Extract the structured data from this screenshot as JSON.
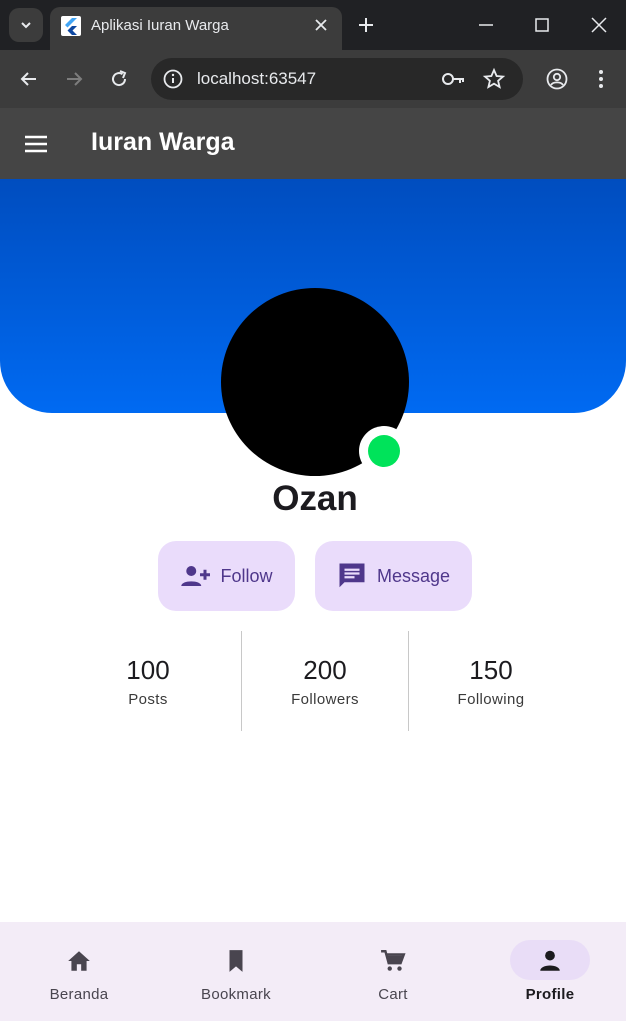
{
  "browser": {
    "tab_title": "Aplikasi Iuran Warga",
    "url": "localhost:63547"
  },
  "app": {
    "title": "Iuran Warga"
  },
  "profile": {
    "name": "Ozan",
    "online": true,
    "status_color": "#00e35a"
  },
  "actions": {
    "follow_label": "Follow",
    "message_label": "Message"
  },
  "stats": [
    {
      "value": "100",
      "label": "Posts"
    },
    {
      "value": "200",
      "label": "Followers"
    },
    {
      "value": "150",
      "label": "Following"
    }
  ],
  "bottom_nav": {
    "items": [
      {
        "label": "Beranda",
        "icon": "home-icon"
      },
      {
        "label": "Bookmark",
        "icon": "bookmark-icon"
      },
      {
        "label": "Cart",
        "icon": "cart-icon"
      },
      {
        "label": "Profile",
        "icon": "person-icon"
      }
    ],
    "active_index": 3
  },
  "colors": {
    "banner_top": "#004dbf",
    "banner_bottom": "#006af2",
    "app_bar": "#454545",
    "button_bg": "#eadcfb",
    "button_fg": "#4f378b",
    "nav_bg": "#f3ecf7"
  }
}
